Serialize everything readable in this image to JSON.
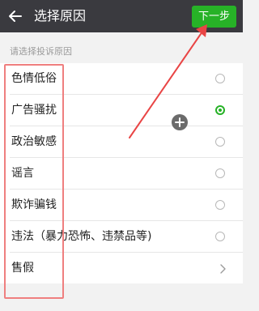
{
  "header": {
    "title": "选择原因",
    "next_label": "下一步"
  },
  "hint": "请选择投诉原因",
  "reasons": [
    {
      "label": "色情低俗",
      "control": "radio",
      "selected": false
    },
    {
      "label": "广告骚扰",
      "control": "radio",
      "selected": true
    },
    {
      "label": "政治敏感",
      "control": "radio",
      "selected": false
    },
    {
      "label": "谣言",
      "control": "radio",
      "selected": false
    },
    {
      "label": "欺诈骗钱",
      "control": "radio",
      "selected": false
    },
    {
      "label": "违法（暴力恐怖、违禁品等)",
      "control": "radio",
      "selected": false
    },
    {
      "label": "售假",
      "control": "chevron",
      "selected": false
    }
  ],
  "colors": {
    "header_bg": "#3a3a3f",
    "accent_green": "#27b227",
    "annotation_red": "#e94545"
  },
  "icons": {
    "back": "arrow-left-icon",
    "chevron": "chevron-right-icon",
    "plus": "plus-circle-icon"
  }
}
